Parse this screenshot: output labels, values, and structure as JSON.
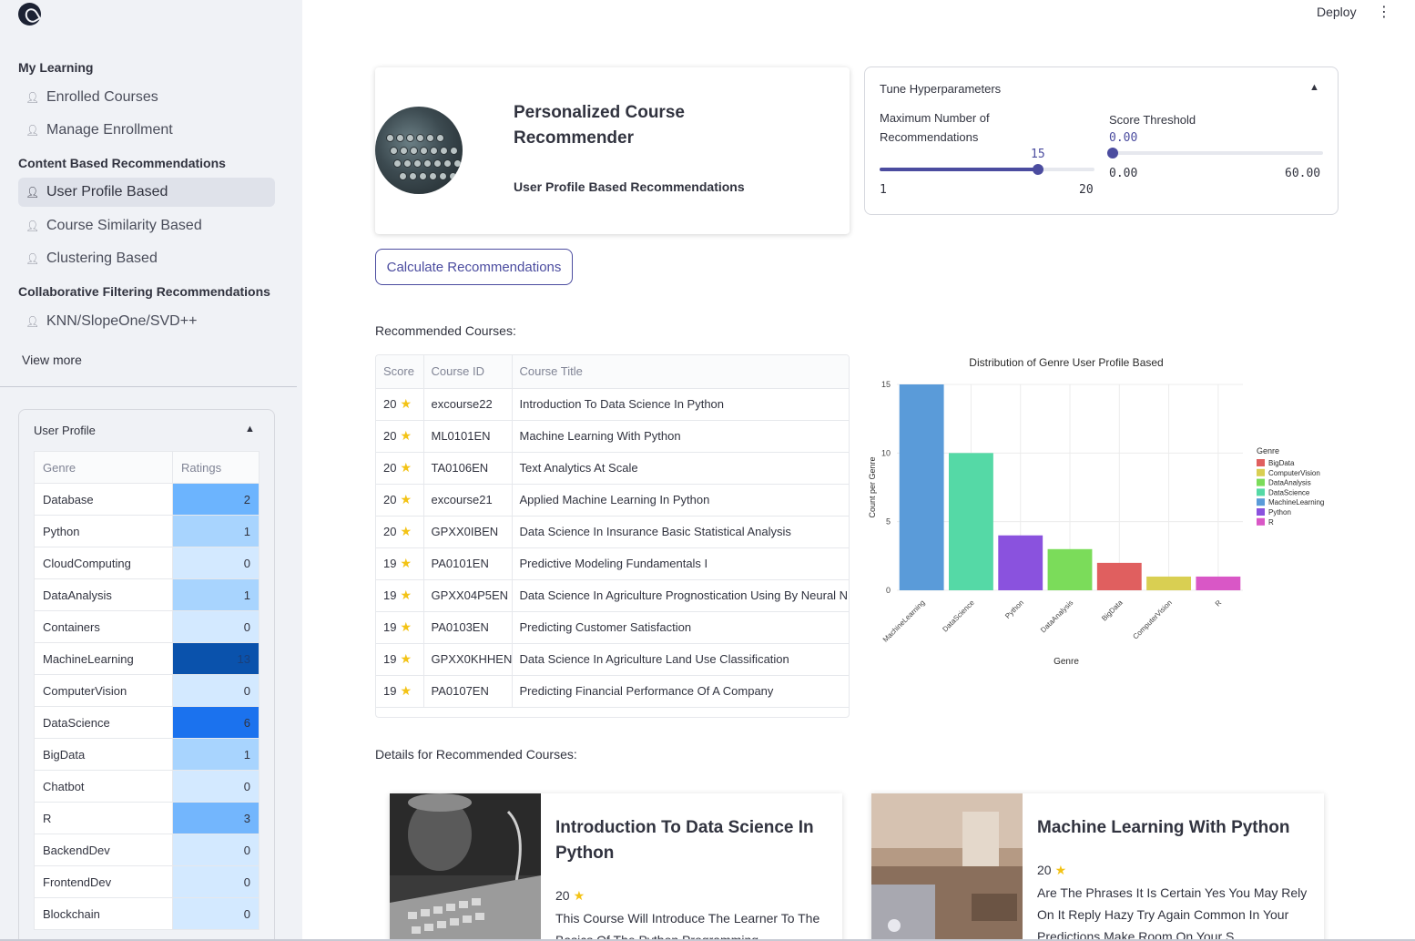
{
  "sidebar": {
    "sections": [
      {
        "heading": "My Learning",
        "items": [
          {
            "label": "Enrolled Courses",
            "icon": "user-plus-icon"
          },
          {
            "label": "Manage Enrollment",
            "icon": "user-plus-icon"
          }
        ]
      },
      {
        "heading": "Content Based Recommendations",
        "items": [
          {
            "label": "User Profile Based",
            "icon": "user-plus-icon",
            "active": true
          },
          {
            "label": "Course Similarity Based",
            "icon": "user-plus-icon"
          },
          {
            "label": "Clustering Based",
            "icon": "user-plus-icon"
          }
        ]
      },
      {
        "heading": "Collaborative Filtering Recommendations",
        "items": [
          {
            "label": "KNN/SlopeOne/SVD++",
            "icon": "user-plus-icon"
          }
        ]
      }
    ],
    "view_more": "View more",
    "profile": {
      "title": "User Profile",
      "columns": [
        "Genre",
        "Ratings"
      ],
      "rows": [
        {
          "genre": "Database",
          "rating": "2",
          "color": "#6cb4fe"
        },
        {
          "genre": "Python",
          "rating": "1",
          "color": "#a8d4fe"
        },
        {
          "genre": "CloudComputing",
          "rating": "0",
          "color": "#d3e9ff"
        },
        {
          "genre": "DataAnalysis",
          "rating": "1",
          "color": "#a8d4fe"
        },
        {
          "genre": "Containers",
          "rating": "0",
          "color": "#d3e9ff"
        },
        {
          "genre": "MachineLearning",
          "rating": "13",
          "color": "#0a52ac"
        },
        {
          "genre": "ComputerVision",
          "rating": "0",
          "color": "#d3e9ff"
        },
        {
          "genre": "DataScience",
          "rating": "6",
          "color": "#1b72ee"
        },
        {
          "genre": "BigData",
          "rating": "1",
          "color": "#a8d4fe"
        },
        {
          "genre": "Chatbot",
          "rating": "0",
          "color": "#d3e9ff"
        },
        {
          "genre": "R",
          "rating": "3",
          "color": "#73b6fd"
        },
        {
          "genre": "BackendDev",
          "rating": "0",
          "color": "#d3e9ff"
        },
        {
          "genre": "FrontendDev",
          "rating": "0",
          "color": "#d3e9ff"
        },
        {
          "genre": "Blockchain",
          "rating": "0",
          "color": "#d3e9ff"
        }
      ]
    }
  },
  "topbar": {
    "deploy": "Deploy",
    "menu_icon": "kebab-menu-icon"
  },
  "header": {
    "title": "Personalized Course Recommender",
    "subtitle": "User Profile Based Recommendations"
  },
  "hyperparameters": {
    "title": "Tune Hyperparameters",
    "max_recs": {
      "label": "Maximum Number of Recommendations",
      "value": "15",
      "min": "1",
      "max": "20"
    },
    "threshold": {
      "label": "Score Threshold",
      "value": "0.00",
      "min": "0.00",
      "max": "60.00"
    }
  },
  "calculate_button": "Calculate Recommendations",
  "recommended": {
    "label": "Recommended Courses:",
    "columns": [
      "Score",
      "Course ID",
      "Course Title"
    ],
    "rows": [
      {
        "score": "20",
        "id": "excourse22",
        "title": "Introduction To Data Science In Python"
      },
      {
        "score": "20",
        "id": "ML0101EN",
        "title": "Machine Learning With Python"
      },
      {
        "score": "20",
        "id": "TA0106EN",
        "title": "Text Analytics At Scale"
      },
      {
        "score": "20",
        "id": "excourse21",
        "title": "Applied Machine Learning In Python"
      },
      {
        "score": "20",
        "id": "GPXX0IBEN",
        "title": "Data Science In Insurance  Basic Statistical Analysis"
      },
      {
        "score": "19",
        "id": "PA0101EN",
        "title": "Predictive Modeling Fundamentals I"
      },
      {
        "score": "19",
        "id": "GPXX04P5EN",
        "title": "Data Science In Agriculture  Prognostication Using By Neural N"
      },
      {
        "score": "19",
        "id": "PA0103EN",
        "title": "Predicting Customer Satisfaction"
      },
      {
        "score": "19",
        "id": "GPXX0KHHEN",
        "title": "Data Science In Agriculture  Land Use Classification"
      },
      {
        "score": "19",
        "id": "PA0107EN",
        "title": "Predicting Financial Performance Of A Company"
      }
    ]
  },
  "chart_data": {
    "type": "bar",
    "title": "Distribution of Genre User Profile Based",
    "xlabel": "Genre",
    "ylabel": "Count per Genre",
    "categories": [
      "MachineLearning",
      "DataScience",
      "Python",
      "DataAnalysis",
      "BigData",
      "ComputerVision",
      "R"
    ],
    "values": [
      15,
      10,
      4,
      3,
      2,
      1,
      1
    ],
    "colors": [
      "#5a9bd9",
      "#55d9a6",
      "#8a52de",
      "#7bdc5a",
      "#e05f5f",
      "#d9cf52",
      "#d957c6"
    ],
    "yticks": [
      0,
      5,
      10,
      15
    ],
    "ylim": [
      0,
      15
    ],
    "grid": true,
    "legend": {
      "title": "Genre",
      "position": "right",
      "entries": [
        {
          "name": "BigData",
          "color": "#e05f5f"
        },
        {
          "name": "ComputerVision",
          "color": "#d9cf52"
        },
        {
          "name": "DataAnalysis",
          "color": "#7bdc5a"
        },
        {
          "name": "DataScience",
          "color": "#55d9a6"
        },
        {
          "name": "MachineLearning",
          "color": "#5a9bd9"
        },
        {
          "name": "Python",
          "color": "#8a52de"
        },
        {
          "name": "R",
          "color": "#d957c6"
        }
      ]
    }
  },
  "details": {
    "label": "Details for Recommended Courses:",
    "cards": [
      {
        "title": "Introduction To Data Science In Python",
        "score": "20",
        "description": "This Course Will Introduce The Learner To The Basics Of The Python Programming"
      },
      {
        "title": "Machine Learning With Python",
        "score": "20",
        "description": "Are The Phrases It Is Certain Yes You May Rely On It Reply Hazy Try Again Common In Your Predictions Make Room On Your S ..."
      }
    ]
  }
}
